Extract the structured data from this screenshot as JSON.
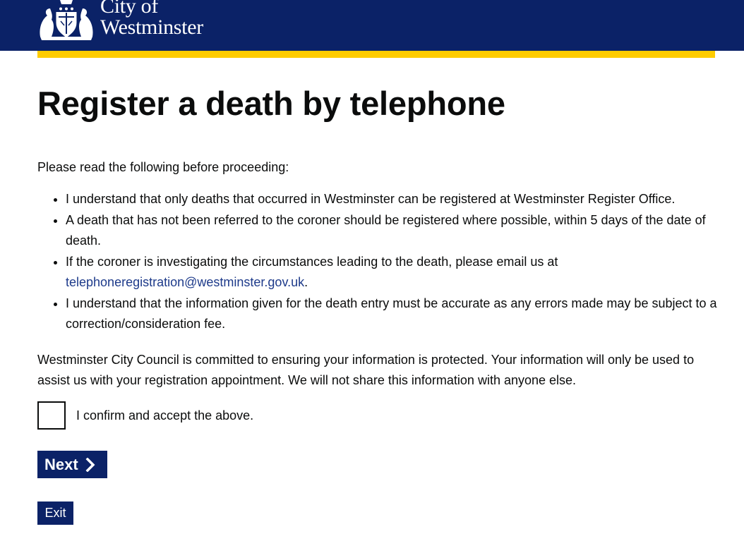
{
  "header": {
    "logo_line1": "City of",
    "logo_line2": "Westminster",
    "logo_icon": "westminster-crest-icon",
    "background_color": "#0b2267",
    "accent_color": "#ffcc00"
  },
  "page": {
    "title": "Register a death by telephone",
    "intro": "Please read the following before proceeding:",
    "terms": [
      {
        "text": "I understand that only deaths that occurred in Westminster can be registered at Westminster Register Office."
      },
      {
        "text": "A death that has not been referred to the coroner should be registered where possible, within 5 days of the date of death."
      },
      {
        "text_before": "If the coroner is investigating the circumstances leading to the death, please email us at ",
        "link": "telephoneregistration@westminster.gov.uk",
        "text_after": "."
      },
      {
        "text": "I understand that the information given for the death entry must be accurate as any errors made may be subject to a correction/consideration fee."
      }
    ],
    "privacy": "Westminster City Council is committed to ensuring your information is protected. Your information will only be used to assist us with your registration appointment. We will not share this information with anyone else.",
    "confirm_label": "I confirm and accept the above.",
    "confirm_checked": false
  },
  "actions": {
    "next_label": "Next",
    "next_icon": "chevron-right-icon",
    "exit_label": "Exit",
    "button_color": "#0b2267"
  }
}
